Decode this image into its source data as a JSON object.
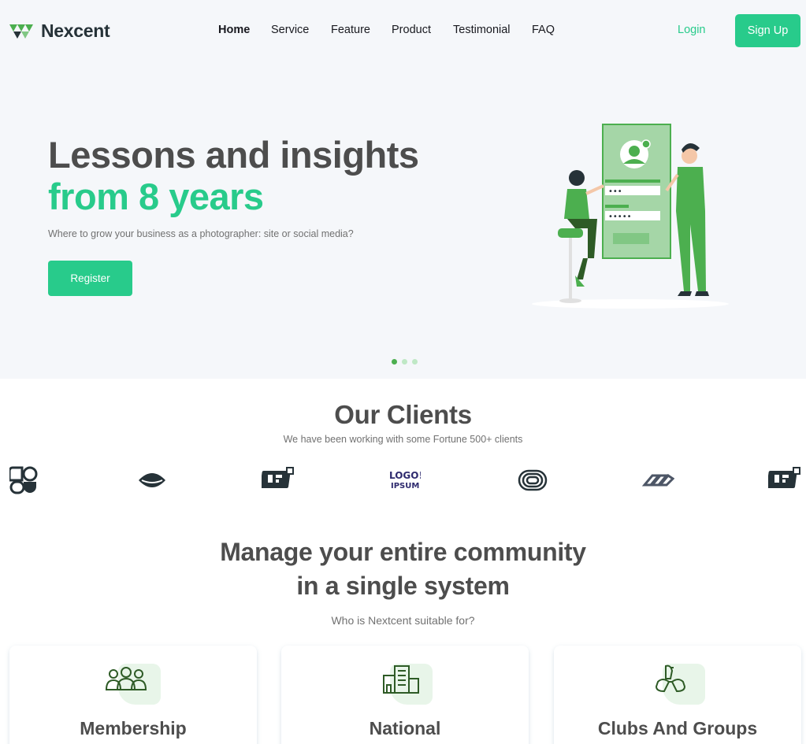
{
  "header": {
    "brand": "Nexcent",
    "nav": [
      "Home",
      "Service",
      "Feature",
      "Product",
      "Testimonial",
      "FAQ"
    ],
    "login": "Login",
    "signup": "Sign Up"
  },
  "hero": {
    "title_line1": "Lessons and insights",
    "title_line2": "from 8 years",
    "subtitle": "Where to grow your business as a photographer: site or social media?",
    "cta": "Register",
    "password_mask_1": "•••",
    "password_mask_2": "•••••",
    "slides": {
      "count": 3,
      "active": 1
    }
  },
  "clients": {
    "title": "Our Clients",
    "subtitle": "We have been working with some Fortune 500+ clients",
    "logos": [
      "client-logo-1",
      "client-logo-2",
      "client-logo-3",
      "client-logo-4",
      "client-logo-5",
      "client-logo-6",
      "client-logo-7"
    ]
  },
  "community": {
    "title_line1": "Manage your entire community",
    "title_line2": "in a single system",
    "subtitle": "Who is Nextcent suitable for?",
    "cards": [
      {
        "title": "Membership",
        "icon": "users-icon"
      },
      {
        "title": "National",
        "icon": "building-icon"
      },
      {
        "title": "Clubs And Groups",
        "icon": "hands-icon"
      }
    ]
  },
  "colors": {
    "primary": "#28cb8b",
    "dark": "#4d4d4d",
    "muted": "#717171",
    "illustration_green": "#4caf4f",
    "background": "#f5f7fa"
  }
}
